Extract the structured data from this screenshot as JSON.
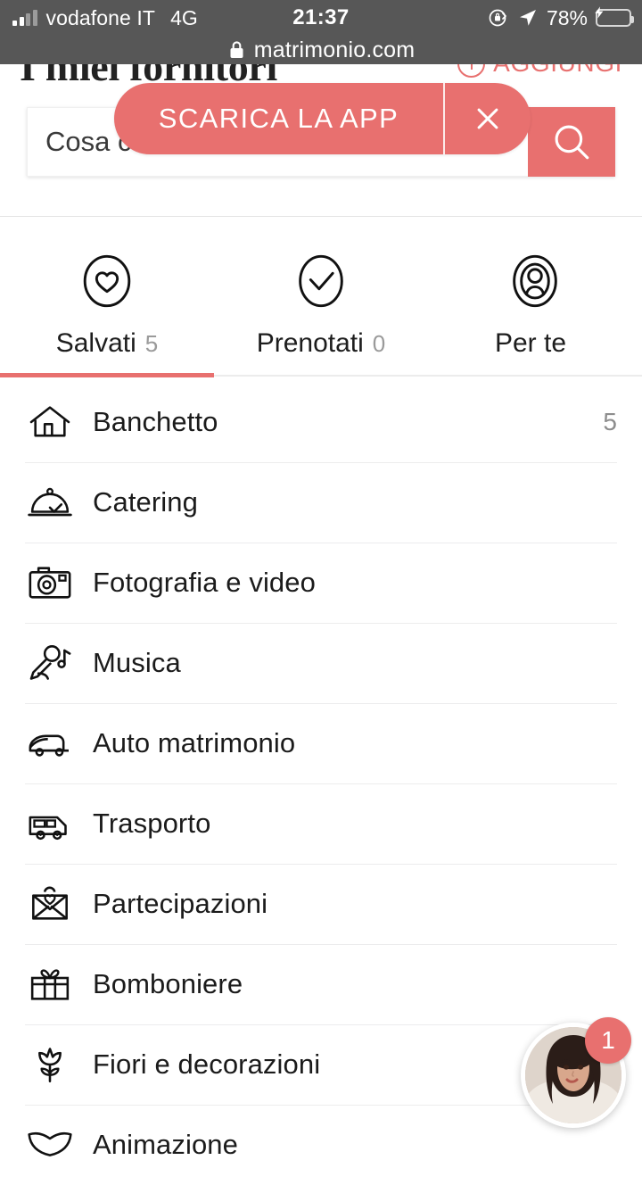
{
  "statusbar": {
    "carrier": "vodafone IT",
    "network": "4G",
    "time": "21:37",
    "battery_pct": "78%",
    "signal_icon": "signal-bars-icon",
    "rotation_lock_icon": "rotation-lock-icon",
    "location_icon": "location-arrow-icon",
    "battery_icon": "battery-charging-icon"
  },
  "browser": {
    "lock_icon": "lock-icon",
    "host": "matrimonio.com"
  },
  "header": {
    "title": "I miei fornitori",
    "add_label": "AGGIUNGI",
    "add_icon": "plus-circle-icon",
    "accent": "#E8706F"
  },
  "search": {
    "placeholder": "Cosa cerchi?",
    "value": "",
    "button_icon": "search-icon"
  },
  "banner": {
    "cta_label": "SCARICA LA APP",
    "close_icon": "close-icon",
    "background": "#E8706F"
  },
  "tabs": {
    "active_index": 0,
    "items": [
      {
        "label": "Salvati",
        "count": "5",
        "icon": "heart-circle-icon"
      },
      {
        "label": "Prenotati",
        "count": "0",
        "icon": "check-circle-icon"
      },
      {
        "label": "Per te",
        "count": "",
        "icon": "person-target-icon"
      }
    ]
  },
  "categories": [
    {
      "label": "Banchetto",
      "count": "5",
      "icon": "house-icon"
    },
    {
      "label": "Catering",
      "count": "",
      "icon": "cloche-icon"
    },
    {
      "label": "Fotografia e video",
      "count": "",
      "icon": "camera-icon"
    },
    {
      "label": "Musica",
      "count": "",
      "icon": "microphone-note-icon"
    },
    {
      "label": "Auto matrimonio",
      "count": "",
      "icon": "car-icon"
    },
    {
      "label": "Trasporto",
      "count": "",
      "icon": "bus-icon"
    },
    {
      "label": "Partecipazioni",
      "count": "",
      "icon": "envelope-heart-icon"
    },
    {
      "label": "Bomboniere",
      "count": "",
      "icon": "gift-icon"
    },
    {
      "label": "Fiori e decorazioni",
      "count": "",
      "icon": "tulip-icon"
    },
    {
      "label": "Animazione",
      "count": "",
      "icon": "mask-icon"
    }
  ],
  "chat": {
    "badge_count": "1",
    "avatar_icon": "advisor-avatar"
  }
}
